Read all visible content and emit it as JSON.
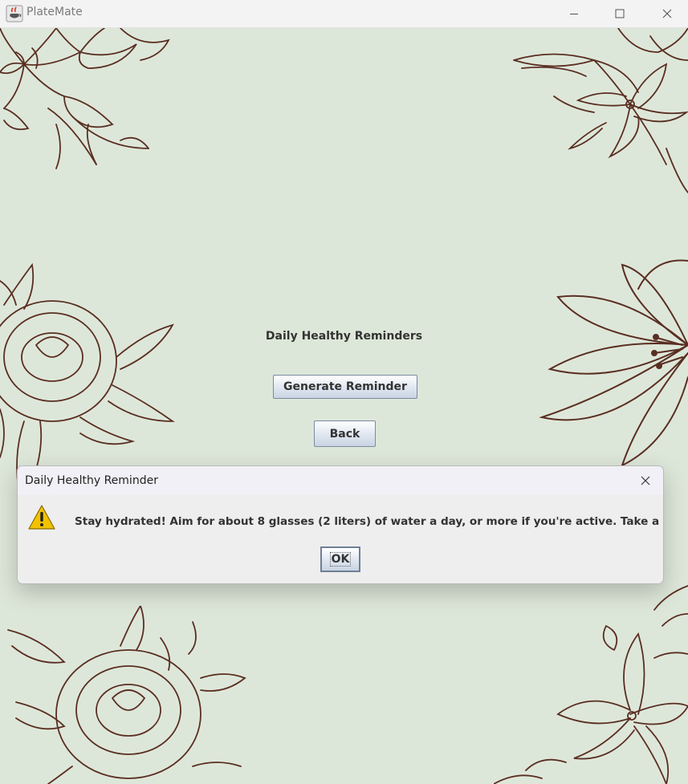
{
  "window": {
    "title": "PlateMate",
    "icon": "java-cup-icon",
    "controls": [
      "minimize-icon",
      "maximize-icon",
      "close-icon"
    ]
  },
  "main": {
    "heading": "Daily Healthy Reminders",
    "generate_button": "Generate Reminder",
    "back_button": "Back"
  },
  "dialog": {
    "title": "Daily Healthy Reminder",
    "icon": "warning-icon",
    "message": "Stay hydrated! Aim for about 8 glasses (2 liters) of water a day, or more if you're active. Take a sip now!.",
    "ok_button": "OK"
  },
  "colors": {
    "background": "#dde7d9",
    "floral_line": "#5a2e22",
    "titlebar": "#f3f3f3",
    "dialog_bg": "#eeeeee",
    "warning": "#f2c200"
  }
}
